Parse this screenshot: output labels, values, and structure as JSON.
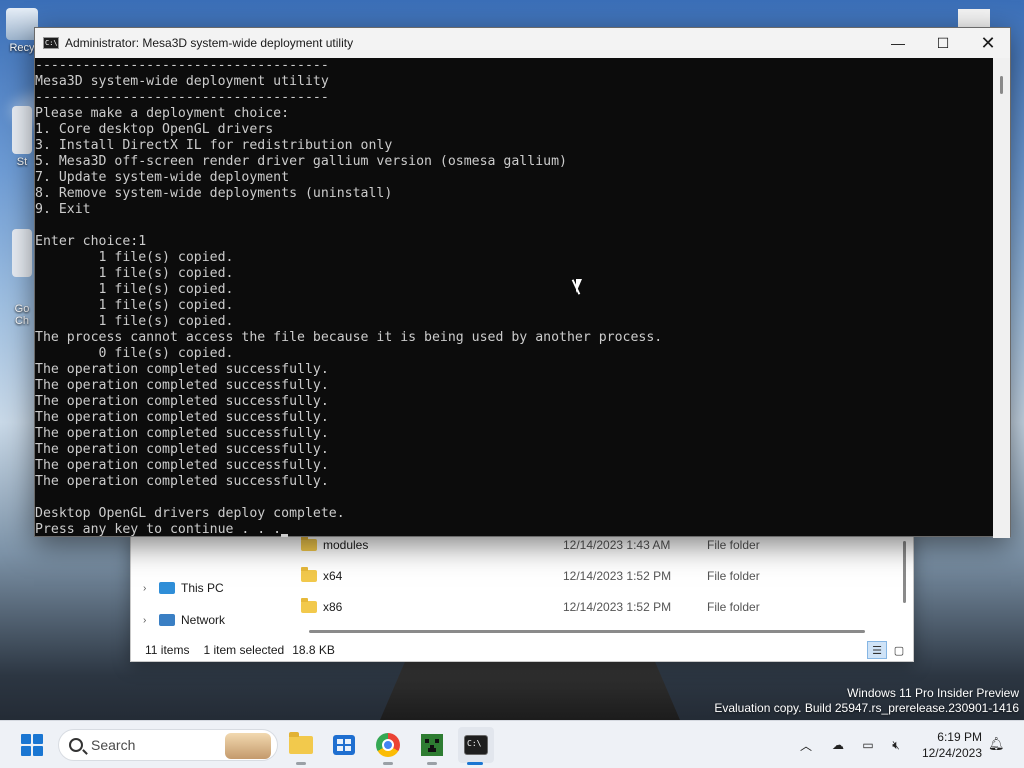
{
  "console": {
    "title": "Administrator:  Mesa3D system-wide deployment utility",
    "icon_text": "C:\\",
    "lines": [
      "-------------------------------------",
      "Mesa3D system-wide deployment utility",
      "-------------------------------------",
      "Please make a deployment choice:",
      "1. Core desktop OpenGL drivers",
      "3. Install DirectX IL for redistribution only",
      "5. Mesa3D off-screen render driver gallium version (osmesa gallium)",
      "7. Update system-wide deployment",
      "8. Remove system-wide deployments (uninstall)",
      "9. Exit",
      "",
      "Enter choice:1",
      "        1 file(s) copied.",
      "        1 file(s) copied.",
      "        1 file(s) copied.",
      "        1 file(s) copied.",
      "        1 file(s) copied.",
      "The process cannot access the file because it is being used by another process.",
      "        0 file(s) copied.",
      "The operation completed successfully.",
      "The operation completed successfully.",
      "The operation completed successfully.",
      "The operation completed successfully.",
      "The operation completed successfully.",
      "The operation completed successfully.",
      "The operation completed successfully.",
      "The operation completed successfully.",
      "",
      "Desktop OpenGL drivers deploy complete.",
      "Press any key to continue . . ."
    ]
  },
  "explorer": {
    "nav": [
      {
        "label": "This PC"
      },
      {
        "label": "Network"
      }
    ],
    "files": [
      {
        "name": "modules",
        "date": "12/14/2023 1:43 AM",
        "type": "File folder"
      },
      {
        "name": "x64",
        "date": "12/14/2023 1:52 PM",
        "type": "File folder"
      },
      {
        "name": "x86",
        "date": "12/14/2023 1:52 PM",
        "type": "File folder"
      }
    ],
    "status": {
      "items": "11 items",
      "selected": "1 item selected",
      "size": "18.8 KB"
    }
  },
  "desktop": {
    "icons": [
      {
        "label": "Recy"
      },
      {
        "label": "St"
      },
      {
        "label": "Go\nCh"
      }
    ],
    "watermark": {
      "line1": "Windows 11 Pro Insider Preview",
      "line2": "Evaluation copy. Build 25947.rs_prerelease.230901-1416"
    }
  },
  "taskbar": {
    "search_placeholder": "Search",
    "time": "6:19 PM",
    "date": "12/24/2023",
    "icons": [
      "start-icon",
      "file-explorer-icon",
      "store-icon",
      "chrome-icon",
      "minecraft-icon",
      "terminal-icon"
    ],
    "tray_icons": [
      "chevron-up-icon",
      "onedrive-icon",
      "display-icon",
      "volume-mute-icon",
      "notification-icon"
    ]
  },
  "colors": {
    "console_bg": "#0c0c0c",
    "console_text": "#cccccc",
    "accent": "#1a76d2"
  }
}
